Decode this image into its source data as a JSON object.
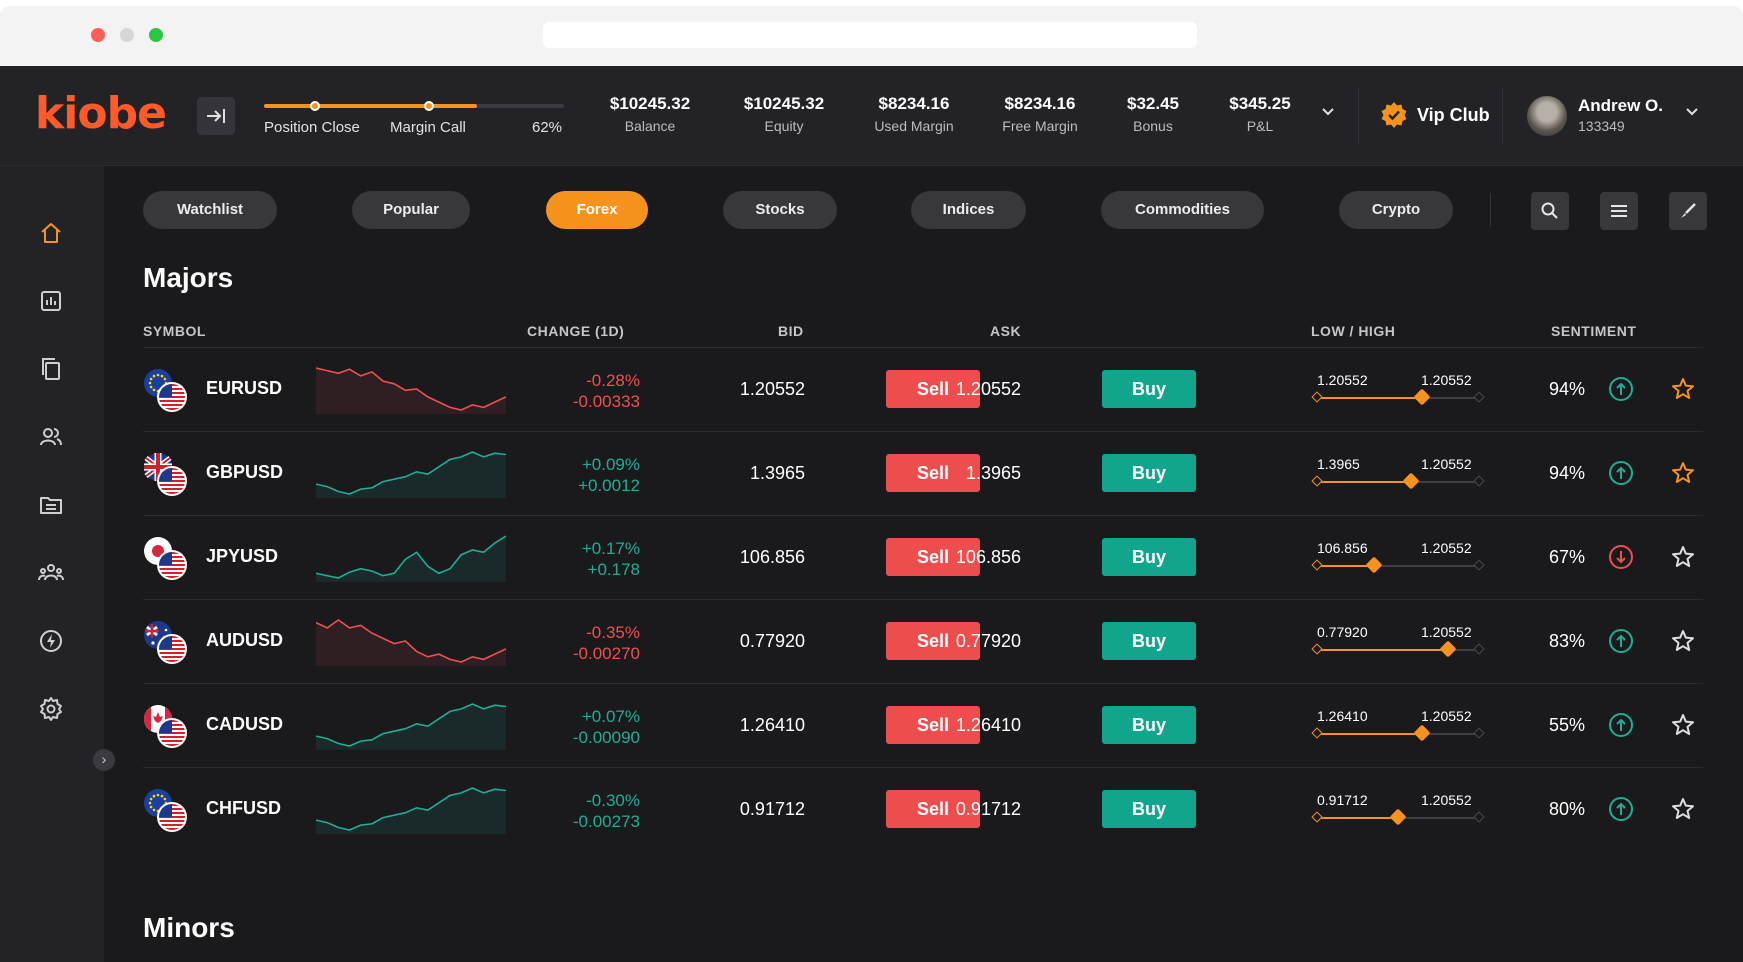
{
  "header": {
    "logo": "kiobe",
    "margin": {
      "label_close": "Position Close",
      "label_call": "Margin Call",
      "percent": "62%",
      "fill_fraction": 0.71,
      "close_marker_fraction": 0.17,
      "call_marker_fraction": 0.55
    },
    "stats": [
      {
        "value": "$10245.32",
        "label": "Balance"
      },
      {
        "value": "$10245.32",
        "label": "Equity"
      },
      {
        "value": "$8234.16",
        "label": "Used Margin"
      },
      {
        "value": "$8234.16",
        "label": "Free Margin"
      },
      {
        "value": "$32.45",
        "label": "Bonus"
      },
      {
        "value": "$345.25",
        "label": "P&L"
      }
    ],
    "vip_label": "Vip Club",
    "user": {
      "name": "Andrew O.",
      "id": "133349"
    }
  },
  "sidebar": {
    "items": [
      "home-icon",
      "chart-icon",
      "copy-icon",
      "users-icon",
      "folder-icon",
      "group-icon",
      "lightning-icon",
      "settings-icon"
    ],
    "toggle": "›"
  },
  "tabs": [
    {
      "label": "Watchlist",
      "active": false
    },
    {
      "label": "Popular",
      "active": false
    },
    {
      "label": "Forex",
      "active": true
    },
    {
      "label": "Stocks",
      "active": false
    },
    {
      "label": "Indices",
      "active": false
    },
    {
      "label": "Commodities",
      "active": false
    },
    {
      "label": "Crypto",
      "active": false
    }
  ],
  "tools": [
    "search-icon",
    "menu-icon",
    "brush-icon"
  ],
  "sections": {
    "majors": "Majors",
    "minors": "Minors"
  },
  "columns": {
    "symbol": "SYMBOL",
    "change": "CHANGE (1D)",
    "bid": "BID",
    "ask": "ASK",
    "low_high": "LOW / HIGH",
    "sentiment": "SENTIMENT"
  },
  "buttons": {
    "sell": "Sell",
    "buy": "Buy"
  },
  "colors": {
    "accent": "#f6921e",
    "sell": "#ee4d4d",
    "buy": "#11a58d",
    "negative": "#ee5050",
    "positive": "#1fae94",
    "background": "#1a1a1d"
  },
  "rows": [
    {
      "symbol": "EURUSD",
      "flag": "eu",
      "change_pct": "-0.28%",
      "change_abs": "-0.00333",
      "trend": "neg",
      "bid": "1.20552",
      "ask": "1.20552",
      "low": "1.20552",
      "high": "1.20552",
      "range_fraction": 0.65,
      "sentiment": "94%",
      "sentiment_dir": "up",
      "favorite": true,
      "spark": [
        8,
        10,
        12,
        9,
        14,
        11,
        18,
        20,
        25,
        24,
        30,
        34,
        38,
        40,
        36,
        38,
        34,
        30
      ]
    },
    {
      "symbol": "GBPUSD",
      "flag": "gb",
      "change_pct": "+0.09%",
      "change_abs": "+0.0012",
      "trend": "pos",
      "bid": "1.3965",
      "ask": "1.3965",
      "low": "1.3965",
      "high": "1.20552",
      "range_fraction": 0.58,
      "sentiment": "94%",
      "sentiment_dir": "up",
      "favorite": true,
      "spark": [
        30,
        32,
        36,
        38,
        34,
        33,
        28,
        26,
        24,
        20,
        22,
        16,
        10,
        8,
        4,
        8,
        5,
        6
      ]
    },
    {
      "symbol": "JPYUSD",
      "flag": "jp",
      "change_pct": "+0.17%",
      "change_abs": "+0.178",
      "trend": "pos",
      "bid": "106.856",
      "ask": "106.856",
      "low": "106.856",
      "high": "1.20552",
      "range_fraction": 0.35,
      "sentiment": "67%",
      "sentiment_dir": "down",
      "favorite": false,
      "spark": [
        34,
        36,
        38,
        33,
        30,
        32,
        36,
        34,
        22,
        16,
        28,
        34,
        30,
        18,
        14,
        16,
        8,
        2
      ]
    },
    {
      "symbol": "AUDUSD",
      "flag": "au",
      "change_pct": "-0.35%",
      "change_abs": "-0.00270",
      "trend": "neg",
      "bid": "0.77920",
      "ask": "0.77920",
      "low": "0.77920",
      "high": "1.20552",
      "range_fraction": 0.81,
      "sentiment": "83%",
      "sentiment_dir": "up",
      "favorite": false,
      "spark": [
        10,
        14,
        8,
        14,
        12,
        18,
        22,
        26,
        24,
        32,
        36,
        34,
        38,
        40,
        36,
        38,
        34,
        30
      ]
    },
    {
      "symbol": "CADUSD",
      "flag": "ca",
      "change_pct": "+0.07%",
      "change_abs": "-0.00090",
      "trend": "pos",
      "bid": "1.26410",
      "ask": "1.26410",
      "low": "1.26410",
      "high": "1.20552",
      "range_fraction": 0.65,
      "sentiment": "55%",
      "sentiment_dir": "up",
      "favorite": false,
      "spark": [
        30,
        32,
        36,
        38,
        34,
        33,
        28,
        26,
        24,
        20,
        22,
        16,
        10,
        8,
        4,
        8,
        5,
        6
      ]
    },
    {
      "symbol": "CHFUSD",
      "flag": "eu",
      "change_pct": "-0.30%",
      "change_abs": "-0.00273",
      "trend": "pos",
      "bid": "0.91712",
      "ask": "0.91712",
      "low": "0.91712",
      "high": "1.20552",
      "range_fraction": 0.5,
      "sentiment": "80%",
      "sentiment_dir": "up",
      "favorite": false,
      "spark": [
        30,
        32,
        36,
        38,
        34,
        33,
        28,
        26,
        24,
        20,
        22,
        16,
        10,
        8,
        4,
        8,
        5,
        6
      ]
    }
  ]
}
